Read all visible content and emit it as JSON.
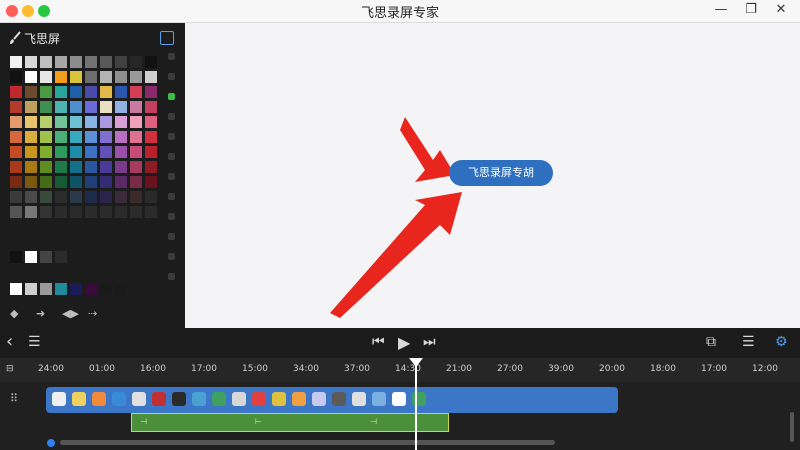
{
  "window": {
    "title": "飞思录屏专家",
    "minimize_label": "—",
    "restore_label": "❐",
    "close_label": "✕"
  },
  "palette": {
    "title": "飞思屏",
    "rows": [
      [
        "#f2f2f2",
        "#d9d9d9",
        "#bfbfbf",
        "#a6a6a6",
        "#8c8c8c",
        "#737373",
        "#595959",
        "#404040",
        "#262626",
        "#111111"
      ],
      [
        "#111111",
        "#ffffff",
        "#e6e6e6",
        "#f29e1c",
        "#d8c43c",
        "#6e6e6e",
        "#b3b3b3",
        "#8e8e8e",
        "#9a9a9a",
        "#d0d0d0"
      ],
      [
        "#c0282e",
        "#6c4a2d",
        "#4a9a44",
        "#2aa39b",
        "#1f5fa8",
        "#4a4aa8",
        "#e2b94a",
        "#2b56b0",
        "#d23f56",
        "#8a2a6a"
      ],
      [
        "#b43a2c",
        "#c0a060",
        "#3f8f51",
        "#4ab2b0",
        "#4f8fd0",
        "#6b6bd8",
        "#e8e0c0",
        "#8fb0e0",
        "#c87aa0",
        "#c24060"
      ],
      [
        "#e39a6a",
        "#e7c66e",
        "#b8d06b",
        "#71c49a",
        "#6cc2d4",
        "#87b3e6",
        "#a99ae2",
        "#d8a0d8",
        "#f0a0b8",
        "#e06080"
      ],
      [
        "#d6683a",
        "#d9ae3e",
        "#9ec24a",
        "#49b07a",
        "#3aa8c0",
        "#5d8fd8",
        "#7f6fd0",
        "#b870c0",
        "#e07090",
        "#d03040"
      ],
      [
        "#c84a22",
        "#c8961e",
        "#7fae2e",
        "#2e9a5e",
        "#1e8ca8",
        "#3c70c0",
        "#6050b8",
        "#9a50a8",
        "#c84a78",
        "#b82030"
      ],
      [
        "#a83a1a",
        "#a87a14",
        "#5e8e20",
        "#1f7a48",
        "#14708a",
        "#2a56a0",
        "#483c98",
        "#7a3a8a",
        "#a83a60",
        "#901a26"
      ],
      [
        "#7a2a12",
        "#7a5810",
        "#456a18",
        "#165a36",
        "#0e5268",
        "#1e3f78",
        "#342c72",
        "#5a2a68",
        "#7a2a48",
        "#6a121c"
      ],
      [
        "#3a3a3a",
        "#4a4a4a",
        "#3a4a3a",
        "#2c2c2c",
        "#2a3a4a",
        "#1e2a4a",
        "#2a244a",
        "#3a2a3a",
        "#3a2a2a",
        "#2a2a2a"
      ],
      [
        "#555555",
        "#777777",
        "#333333",
        "#2b2b2b",
        "#2b2b2b",
        "#2b2b2b",
        "#2b2b2b",
        "#2b2b2b",
        "#2b2b2b",
        "#2b2b2b"
      ]
    ],
    "extra_row_1": [
      "#111111",
      "#ffffff",
      "#444444",
      "#2b2b2b"
    ],
    "extra_row_2": [
      "#ffffff",
      "#cfcfcf",
      "#9a9a9a",
      "#1f8a9a",
      "#1b1b5a",
      "#3a0a3a",
      "#1a1a1a",
      "#1a1a1a"
    ],
    "bottom_icons": [
      "◆",
      "➜",
      "◀▶",
      "⇢"
    ]
  },
  "canvas": {
    "callout_text": "飞思录屏专胡",
    "arrow_color": "#e8261e",
    "callout_color": "#2f6fbf"
  },
  "toolbar": {
    "back_icon": "‹",
    "list_icon": "☰",
    "prev_icon": "⏮",
    "play_icon": "▶",
    "next_icon": "⏭",
    "export_icon": "⧉",
    "menu_icon": "☰",
    "settings_icon": "⚙"
  },
  "ruler": {
    "label_icon": "⊟",
    "ticks": [
      "24:00",
      "01:00",
      "16:00",
      "17:00",
      "15:00",
      "34:00",
      "37:00",
      "14:30",
      "21:00",
      "27:00",
      "39:00",
      "20:00",
      "18:00",
      "17:00",
      "12:00"
    ]
  },
  "timeline": {
    "grip_icon": "⠿",
    "green_labels": [
      "⊣",
      "⊢",
      "⊣"
    ],
    "clip_colors": [
      "#f0f0f0",
      "#f0d060",
      "#f08a3a",
      "#3a8ad8",
      "#e0e0e0",
      "#c03030",
      "#2a2a2a",
      "#4aa0d0",
      "#40a060",
      "#d8d8d8",
      "#e04040",
      "#e0c040",
      "#f0a040",
      "#c8c8f0",
      "#5a5a5a",
      "#e0e0e0",
      "#7ab0e0",
      "#ffffff",
      "#40a060"
    ]
  }
}
